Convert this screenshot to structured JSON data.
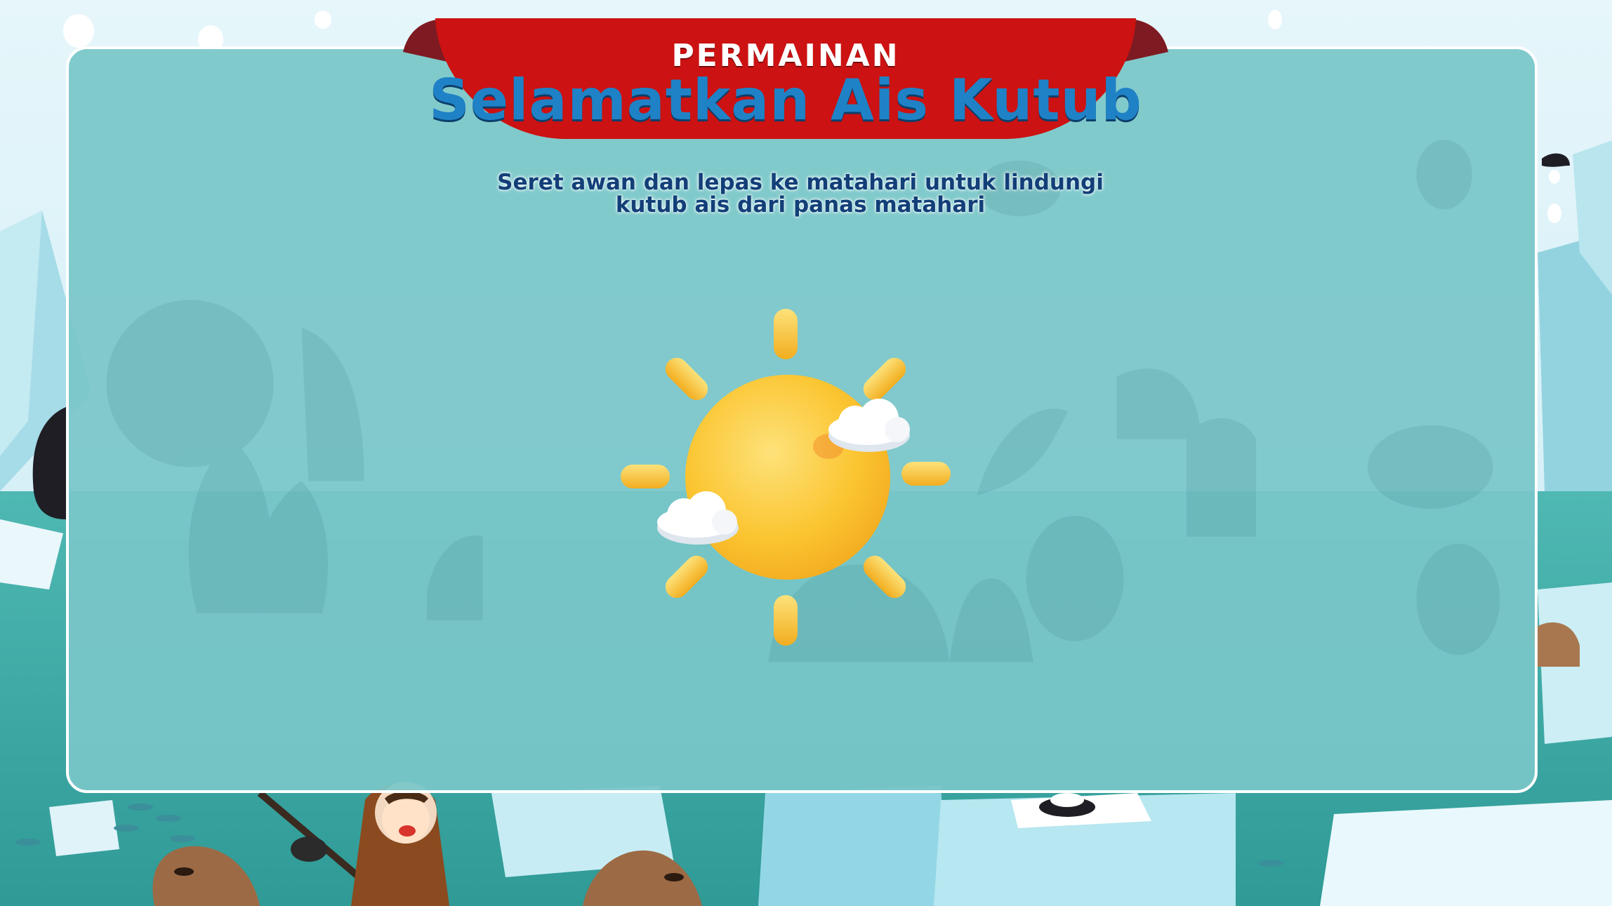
{
  "title": {
    "label": "PERMAINAN",
    "name": "Selamatkan Ais Kutub"
  },
  "instruction": {
    "line1": "Seret awan dan lepas ke matahari untuk lindungi",
    "line2": "kutub ais dari panas matahari"
  },
  "colors": {
    "banner_red": "#cc1212",
    "banner_dark_red": "#7e1b22",
    "title_blue": "#1f82c6",
    "instruction_blue": "#123f78",
    "panel": "#7ac6c8",
    "sun": "#fbc531",
    "ray": "#f9c236",
    "cloud": "#ffffff"
  },
  "game": {
    "sun": "sun-icon",
    "clouds": [
      "cloud-icon",
      "cloud-icon"
    ],
    "rays": 8
  }
}
